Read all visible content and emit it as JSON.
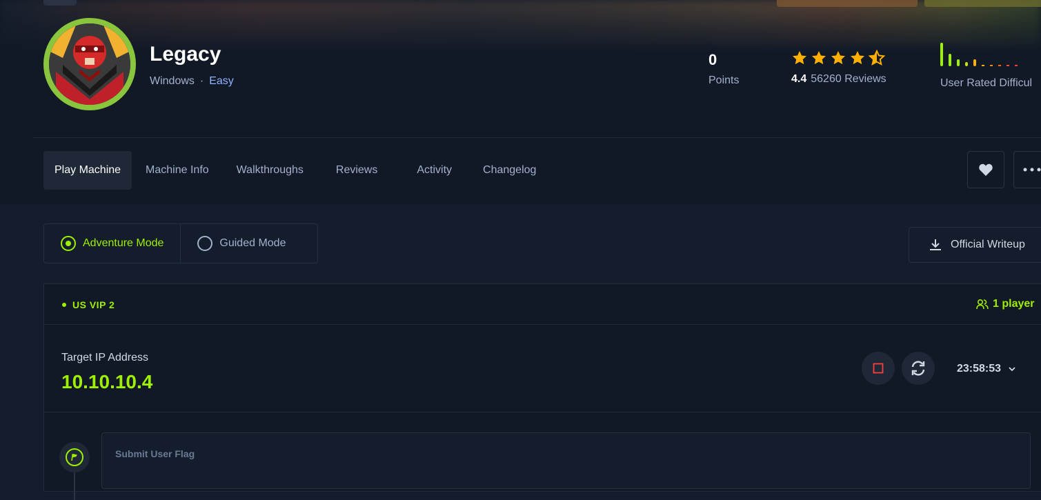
{
  "machine": {
    "name": "Legacy",
    "os": "Windows",
    "separator": "·",
    "difficulty": "Easy"
  },
  "stats": {
    "points_value": "0",
    "points_label": "Points",
    "rating_value": "4.4",
    "rating_stars": 4.4,
    "reviews_text": "56260 Reviews",
    "difficulty_label": "User Rated Difficul"
  },
  "tabs": [
    {
      "label": "Play Machine",
      "active": true
    },
    {
      "label": "Machine Info"
    },
    {
      "label": "Walkthroughs"
    },
    {
      "label": "Reviews"
    },
    {
      "label": "Activity"
    },
    {
      "label": "Changelog"
    }
  ],
  "actions": {
    "favorite_icon": "heart-icon",
    "more_icon": "more-icon"
  },
  "modes": {
    "adventure": "Adventure Mode",
    "guided": "Guided Mode",
    "selected": "adventure"
  },
  "writeup": {
    "label": "Official Writeup"
  },
  "instance": {
    "server": "US VIP 2",
    "players": "1 player",
    "target_label": "Target IP Address",
    "target_ip": "10.10.10.4",
    "timer": "23:58:53"
  },
  "flag": {
    "label": "Submit User Flag"
  },
  "colors": {
    "accent_green": "#9fef00",
    "star": "#ffaf00",
    "stop_red": "#ff3e3e",
    "background": "#141d2b"
  }
}
